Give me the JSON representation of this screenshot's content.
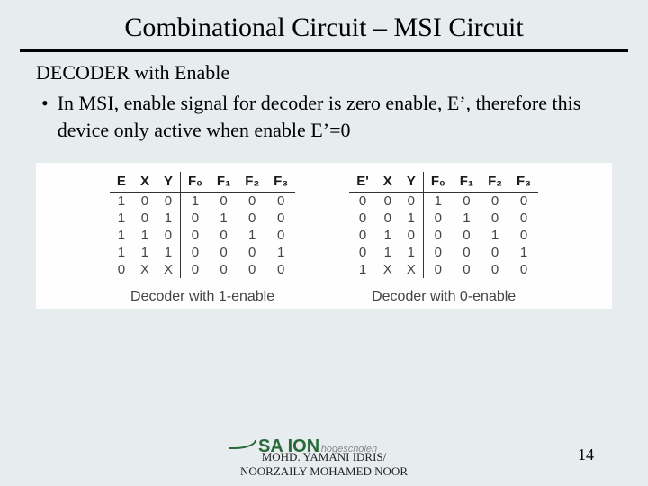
{
  "title": "Combinational Circuit – MSI Circuit",
  "subhead": "DECODER with Enable",
  "bullet_text": "In MSI, enable signal for decoder is zero enable, E’, therefore this device only active when enable E’=0",
  "chart_data": [
    {
      "type": "table",
      "caption": "Decoder with 1-enable",
      "headers": [
        "E",
        "X",
        "Y",
        "F₀",
        "F₁",
        "F₂",
        "F₃"
      ],
      "input_cols": 3,
      "rows": [
        {
          "v": [
            "1",
            "0",
            "0",
            "1",
            "0",
            "0",
            "0"
          ],
          "hl": "blue"
        },
        {
          "v": [
            "1",
            "0",
            "1",
            "0",
            "1",
            "0",
            "0"
          ],
          "hl": "blue"
        },
        {
          "v": [
            "1",
            "1",
            "0",
            "0",
            "0",
            "1",
            "0"
          ],
          "hl": "blue"
        },
        {
          "v": [
            "1",
            "1",
            "1",
            "0",
            "0",
            "0",
            "1"
          ],
          "hl": "blue"
        },
        {
          "v": [
            "0",
            "X",
            "X",
            "0",
            "0",
            "0",
            "0"
          ],
          "hl": "blue"
        }
      ]
    },
    {
      "type": "table",
      "caption": "Decoder with 0-enable",
      "headers": [
        "E'",
        "X",
        "Y",
        "F₀",
        "F₁",
        "F₂",
        "F₃"
      ],
      "input_cols": 3,
      "rows": [
        {
          "v": [
            "0",
            "0",
            "0",
            "1",
            "0",
            "0",
            "0"
          ],
          "hl": "red"
        },
        {
          "v": [
            "0",
            "0",
            "1",
            "0",
            "1",
            "0",
            "0"
          ],
          "hl": "red"
        },
        {
          "v": [
            "0",
            "1",
            "0",
            "0",
            "0",
            "1",
            "0"
          ],
          "hl": "red"
        },
        {
          "v": [
            "0",
            "1",
            "1",
            "0",
            "0",
            "0",
            "1"
          ],
          "hl": "red"
        },
        {
          "v": [
            "1",
            "X",
            "X",
            "0",
            "0",
            "0",
            "0"
          ],
          "hl": "red"
        }
      ]
    }
  ],
  "logo_text": "SA ION",
  "logo_sub": "hogescholen",
  "author_line1": "MOHD. YAMANI IDRIS/",
  "author_line2": "NOORZAILY MOHAMED NOOR",
  "page_number": "14"
}
